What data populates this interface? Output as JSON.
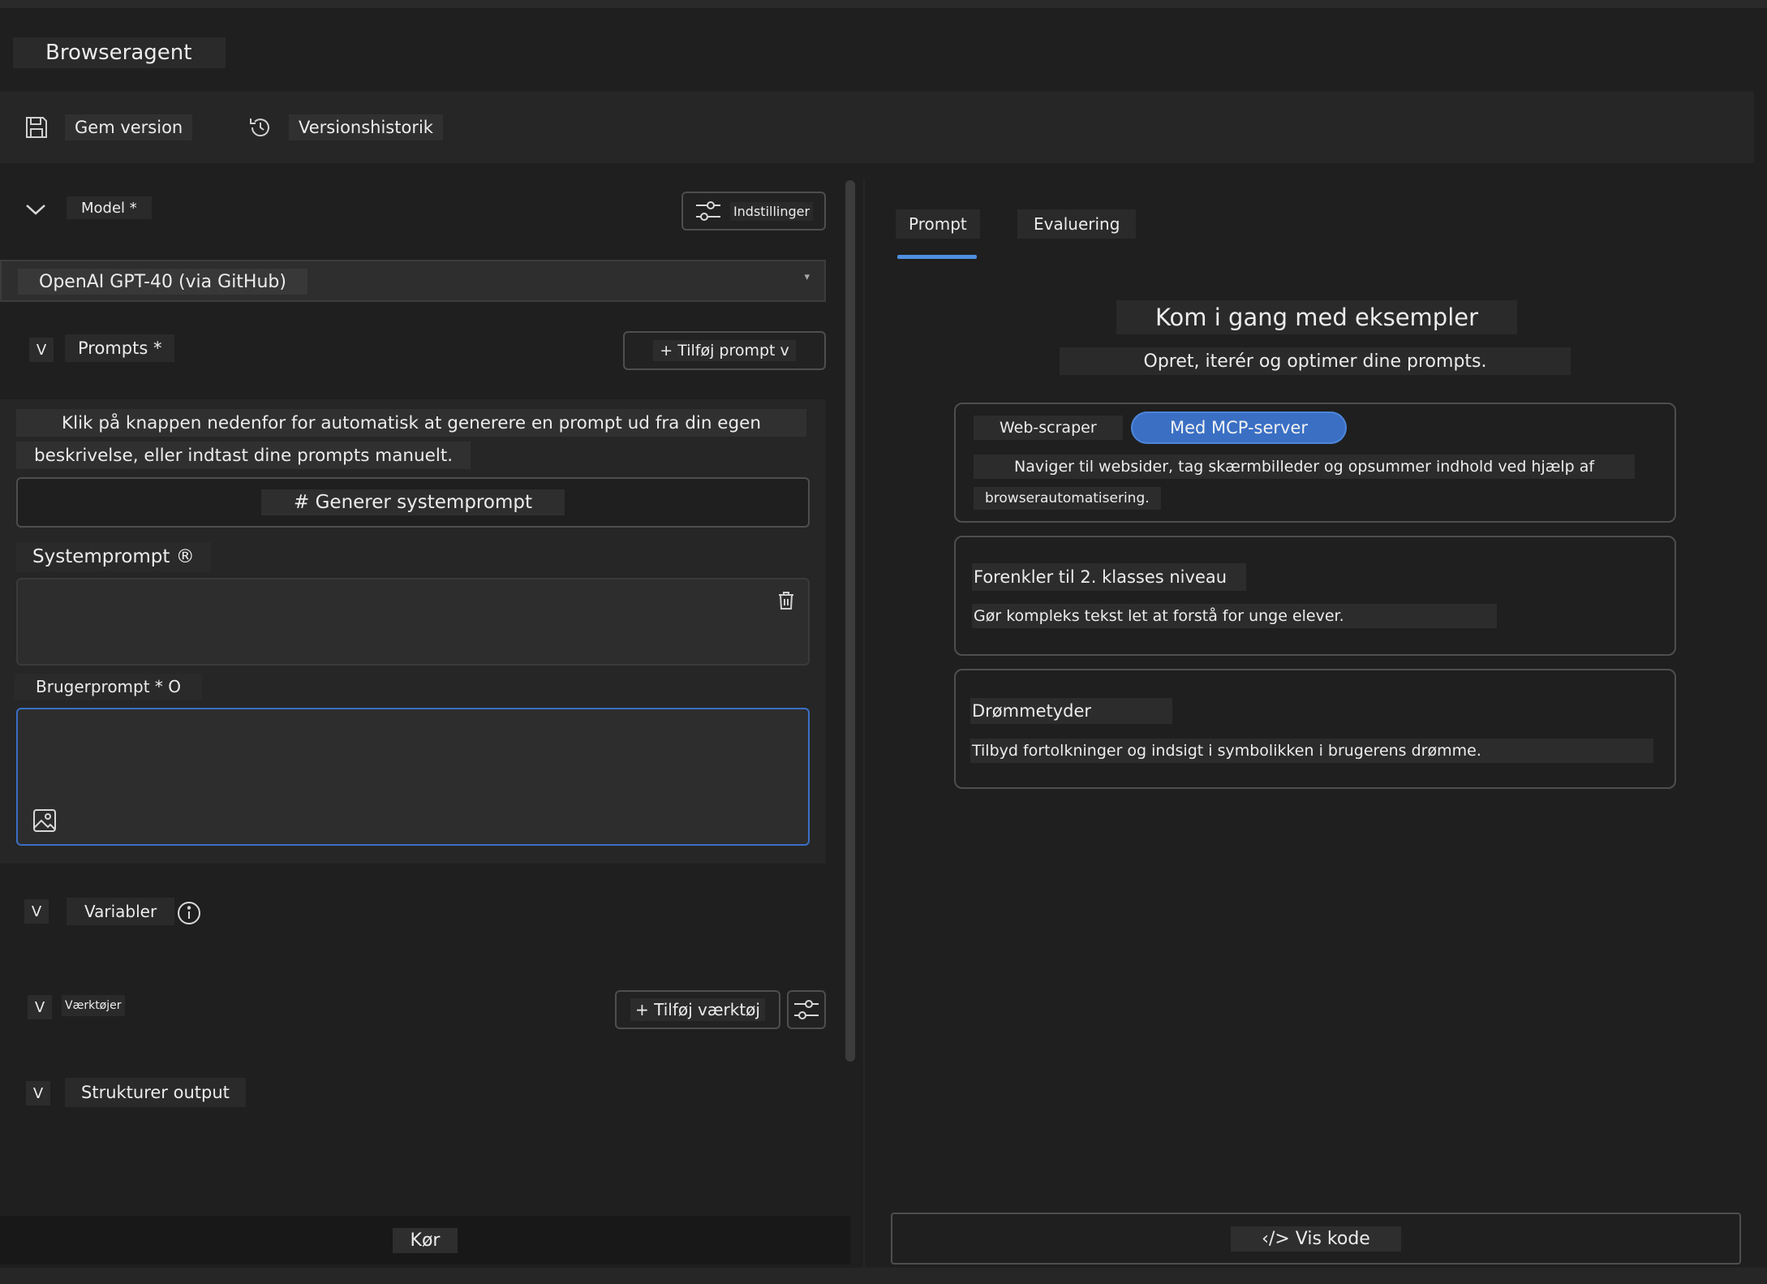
{
  "app": {
    "title": "Browseragent"
  },
  "toolbar": {
    "save_label": "Gem version",
    "history_label": "Versionshistorik"
  },
  "left": {
    "model": {
      "label": "Model *",
      "settings_label": "Indstillinger",
      "selected": "OpenAI GPT-40 (via GitHub)"
    },
    "prompts": {
      "toggle": "V",
      "label": "Prompts *",
      "add_label": "+ Tilføj prompt v",
      "hint_line1": "Klik på knappen nedenfor for automatisk at generere en prompt ud fra din egen",
      "hint_line2": "beskrivelse, eller indtast dine prompts manuelt.",
      "generate_label": "# Generer systemprompt",
      "system_label": "Systemprompt ®",
      "system_value": "",
      "user_label": "Brugerprompt * O",
      "user_value": ""
    },
    "variables": {
      "toggle": "V",
      "label": "Variabler"
    },
    "tools": {
      "toggle": "V",
      "label": "Værktøjer",
      "add_label": "+ Tilføj værktøj"
    },
    "structured": {
      "toggle": "V",
      "label": "Strukturer output"
    },
    "run_label": "Kør"
  },
  "right": {
    "tabs": [
      "Prompt",
      "Evaluering"
    ],
    "active_tab": 0,
    "heading": "Kom i gang med eksempler",
    "subheading": "Opret, iterér og optimer dine prompts.",
    "cards": [
      {
        "tag1": "Web-scraper",
        "tag2": "Med MCP-server",
        "desc1": "Naviger til websider, tag skærmbilleder og opsummer indhold ved hjælp af",
        "desc2": "browserautomatisering."
      },
      {
        "title": "Forenkler til 2. klasses niveau",
        "desc": "Gør kompleks tekst let at forstå for unge elever."
      },
      {
        "title": "Drømmetyder",
        "desc": "Tilbyd fortolkninger og indsigt i symbolikken i brugerens drømme."
      }
    ],
    "code_label": "‹/> Vis kode"
  },
  "colors": {
    "accent": "#3a6fc4",
    "tab_underline": "#4f8fe0",
    "focus_border": "#3a6fc4"
  }
}
